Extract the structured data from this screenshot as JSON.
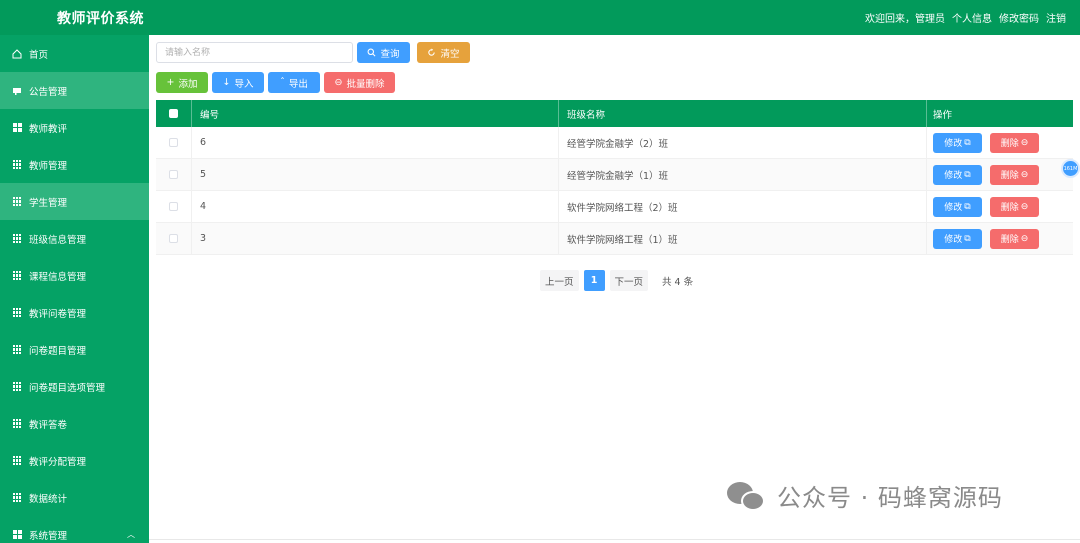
{
  "app": {
    "title": "教师评价系统",
    "welcome": "欢迎回来，管理员",
    "profile": "个人信息",
    "change_password": "修改密码",
    "logout": "注销"
  },
  "sidebar": {
    "items": [
      {
        "label": "首页",
        "icon": "home-icon"
      },
      {
        "label": "公告管理",
        "icon": "notice-icon"
      },
      {
        "label": "教师教评",
        "icon": "grid-icon"
      },
      {
        "label": "教师管理",
        "icon": "grid-icon"
      },
      {
        "label": "学生管理",
        "icon": "grid-icon"
      },
      {
        "label": "班级信息管理",
        "icon": "grid-icon"
      },
      {
        "label": "课程信息管理",
        "icon": "grid-icon"
      },
      {
        "label": "教评问卷管理",
        "icon": "grid-icon"
      },
      {
        "label": "问卷题目管理",
        "icon": "grid-icon"
      },
      {
        "label": "问卷题目选项管理",
        "icon": "grid-icon"
      },
      {
        "label": "教评答卷",
        "icon": "grid-icon"
      },
      {
        "label": "教评分配管理",
        "icon": "grid-icon"
      },
      {
        "label": "数据统计",
        "icon": "grid-icon"
      },
      {
        "label": "系统管理",
        "icon": "grid4-icon"
      }
    ]
  },
  "search": {
    "placeholder": "请输入名称",
    "query_label": "查询",
    "reset_label": "清空"
  },
  "toolbar": {
    "add_label": "添加",
    "import_label": "导入",
    "export_label": "导出",
    "batch_delete_label": "批量删除"
  },
  "table": {
    "headers": [
      "编号",
      "班级名称",
      "操作"
    ],
    "rows": [
      {
        "id": "6",
        "name": "经管学院金融学（2）班"
      },
      {
        "id": "5",
        "name": "经管学院金融学（1）班"
      },
      {
        "id": "4",
        "name": "软件学院网络工程（2）班"
      },
      {
        "id": "3",
        "name": "软件学院网络工程（1）班"
      }
    ],
    "edit_label": "修改",
    "delete_label": "删除"
  },
  "pagination": {
    "prev": "上一页",
    "current": "1",
    "next": "下一页",
    "total": "共 4 条"
  },
  "float_badge": "161M",
  "watermark": "公众号 · 码蜂窝源码",
  "colors": {
    "primary_green": "#029a5b",
    "sidebar_green": "#05a265",
    "blue": "#409eff",
    "orange": "#e6a23c",
    "green_btn": "#67c23a",
    "red": "#f56c6c"
  }
}
